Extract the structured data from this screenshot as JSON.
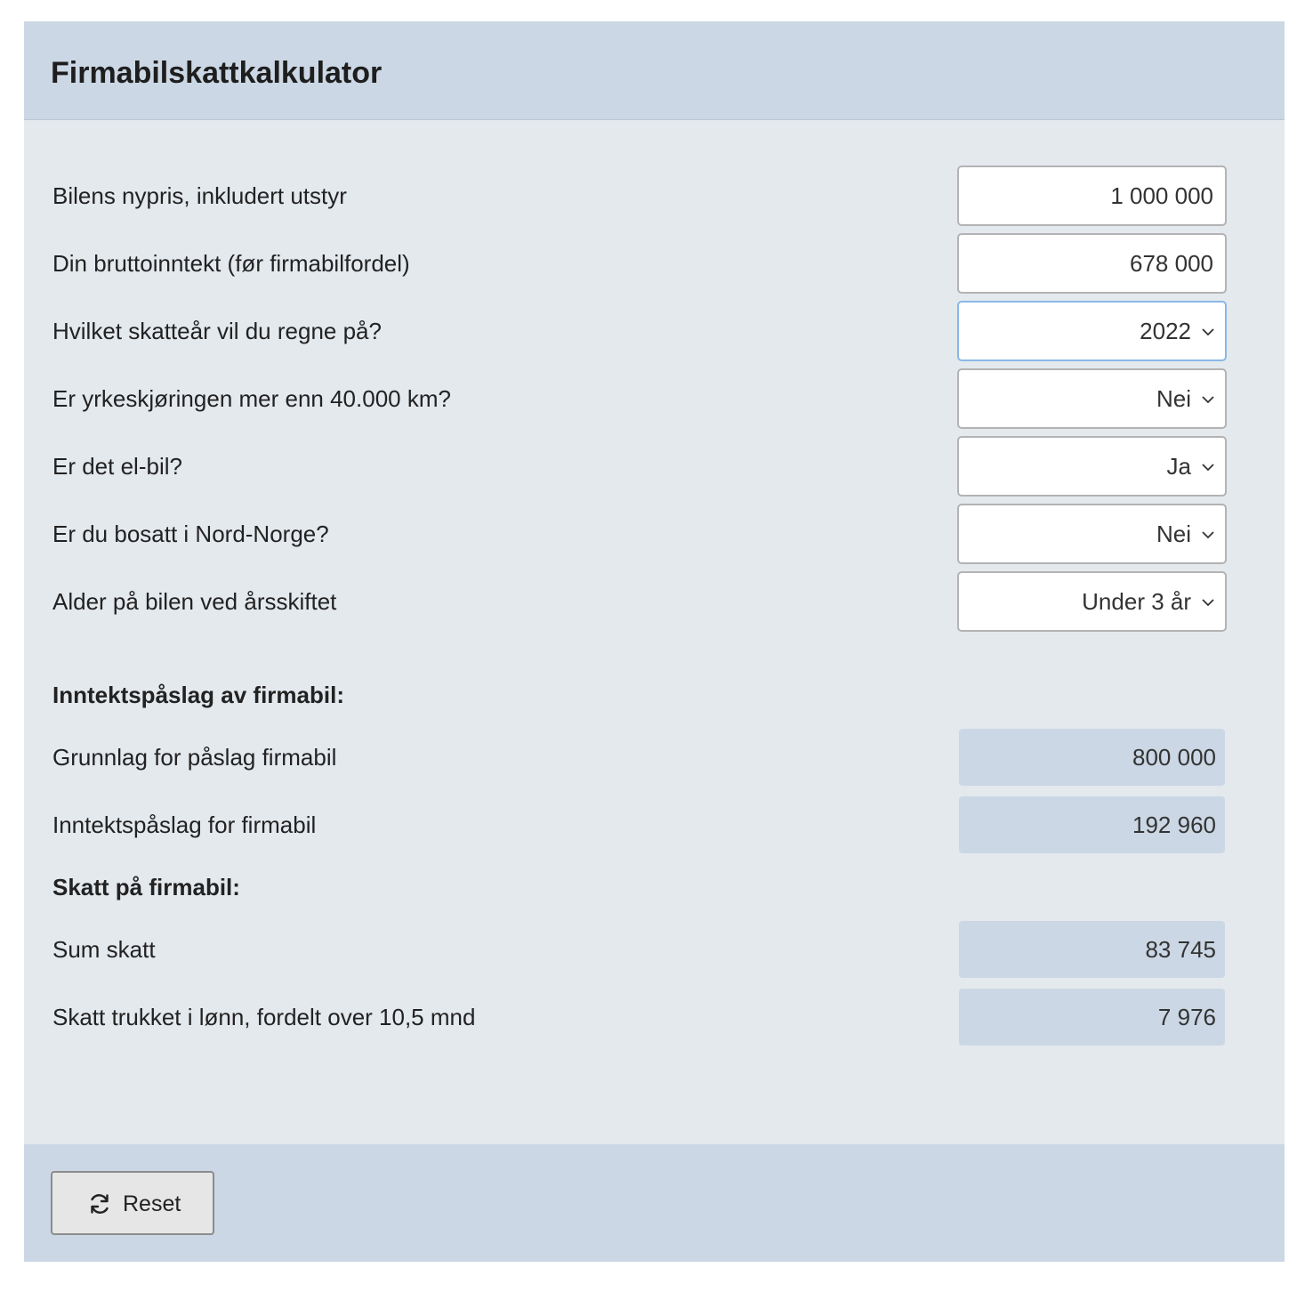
{
  "title": "Firmabilskattkalkulator",
  "inputs": [
    {
      "label": "Bilens nypris, inkludert utstyr",
      "value": "1 000 000",
      "type": "text"
    },
    {
      "label": "Din bruttoinntekt (før firmabilfordel)",
      "value": "678 000",
      "type": "text"
    },
    {
      "label": "Hvilket skatteår vil du regne på?",
      "value": "2022",
      "type": "select"
    },
    {
      "label": "Er yrkeskjøringen mer enn 40.000 km?",
      "value": "Nei",
      "type": "select"
    },
    {
      "label": "Er det el-bil?",
      "value": "Ja",
      "type": "select"
    },
    {
      "label": "Er du bosatt i Nord-Norge?",
      "value": "Nei",
      "type": "select"
    },
    {
      "label": "Alder på bilen ved årsskiftet",
      "value": "Under 3 år",
      "type": "select"
    }
  ],
  "section_income": {
    "heading": "Inntektspåslag av firmabil:",
    "rows": [
      {
        "label": "Grunnlag for påslag firmabil",
        "value": "800 000"
      },
      {
        "label": "Inntektspåslag for firmabil",
        "value": "192 960"
      }
    ]
  },
  "section_tax": {
    "heading": "Skatt på firmabil:",
    "rows": [
      {
        "label": "Sum skatt",
        "value": "83 745"
      },
      {
        "label": "Skatt trukket i lønn, fordelt over 10,5 mnd",
        "value": "7 976"
      }
    ]
  },
  "footer": {
    "reset_label": "Reset",
    "reset_icon": "refresh-icon"
  },
  "colors": {
    "header_bg": "#cbd7e4",
    "body_bg": "#e4e9ee",
    "output_bg": "#cbd7e4",
    "focus_border": "#8ab8e6"
  }
}
